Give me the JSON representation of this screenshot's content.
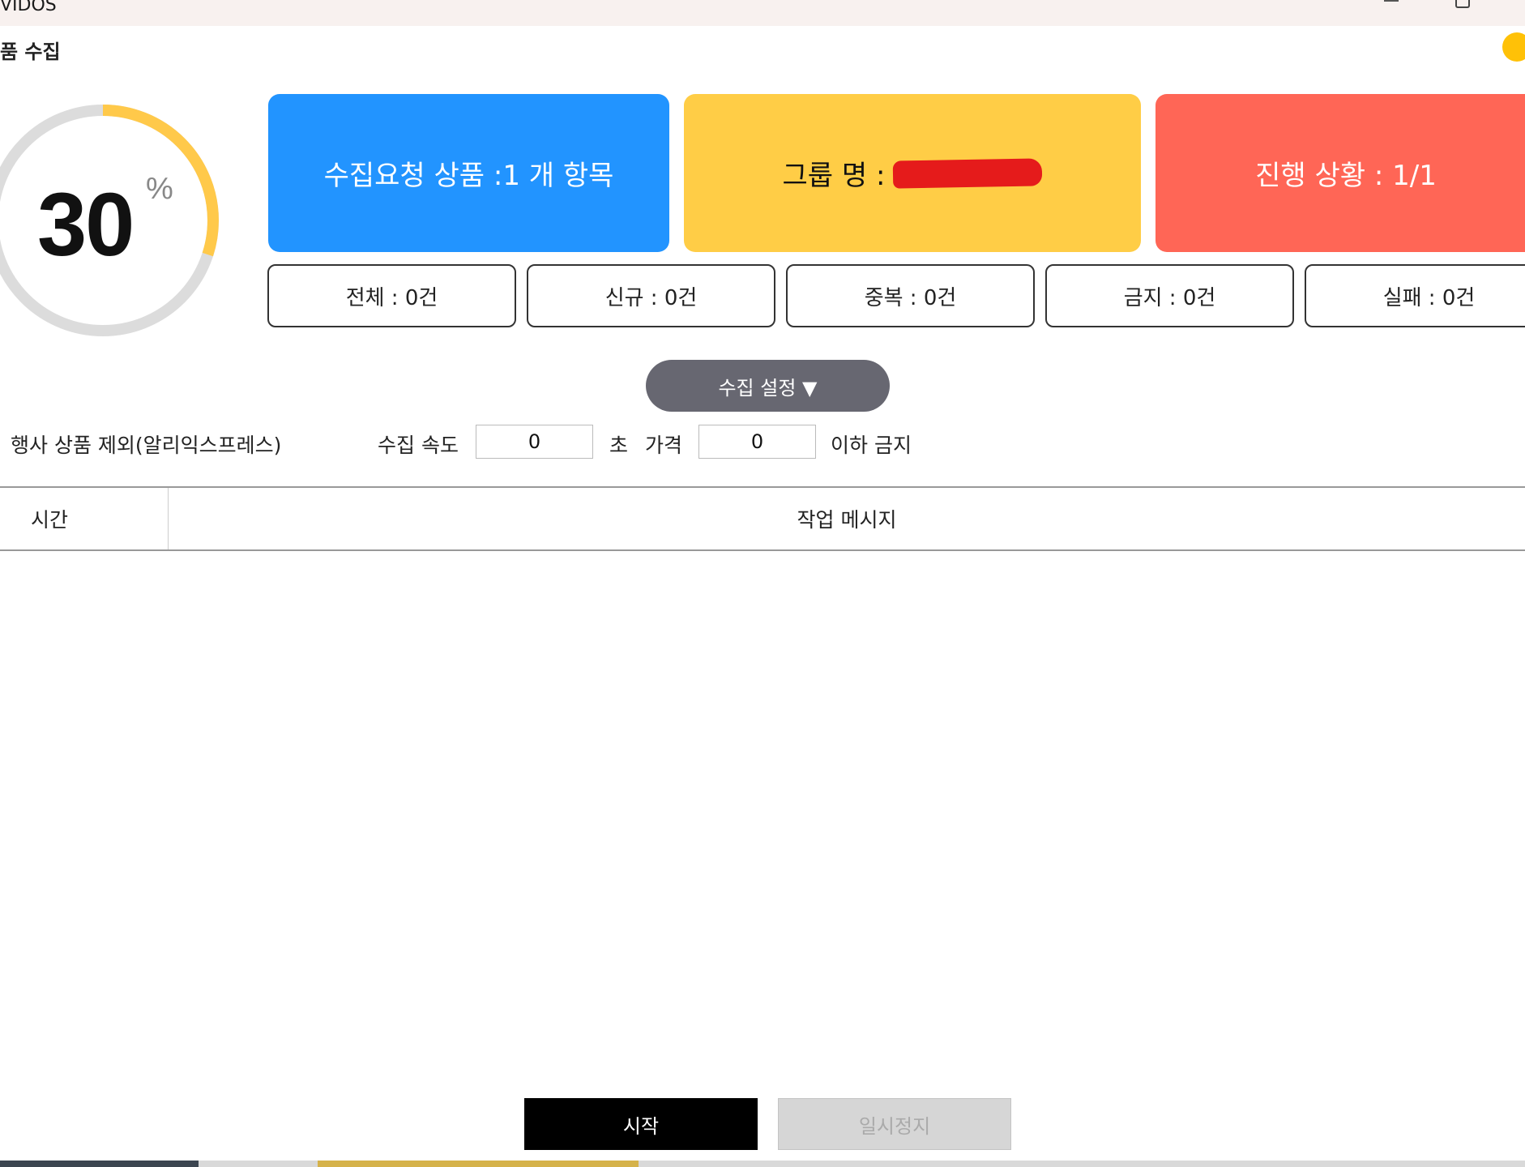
{
  "window": {
    "title": "VIDOS"
  },
  "page": {
    "heading": "품 수집"
  },
  "progress": {
    "value": "30",
    "unit": "%",
    "percent": 30,
    "track_color": "#dcdcdc",
    "fill_color": "#ffc94a"
  },
  "cards": {
    "request": "수집요청 상품 :1 개 항목",
    "group": "그룹 명 :",
    "status": "진행 상황 : 1/1"
  },
  "counts": [
    {
      "label": "전체 : 0건"
    },
    {
      "label": "신규 : 0건"
    },
    {
      "label": "중복 : 0건"
    },
    {
      "label": "금지 : 0건"
    },
    {
      "label": "실패 : 0건"
    }
  ],
  "settings": {
    "toggle_label": "수집 설정 ▼",
    "exclude_event_label": "행사 상품 제외(알리익스프레스)",
    "speed_label": "수집 속도",
    "speed_value": "0",
    "seconds_label": "초",
    "price_label": "가격",
    "price_value": "0",
    "below_ban_label": "이하 금지"
  },
  "log_table": {
    "columns": [
      "시간",
      "작업 메시지"
    ],
    "rows": []
  },
  "actions": {
    "start": "시작",
    "pause": "일시정지"
  },
  "colors": {
    "blue": "#2294ff",
    "yellow": "#ffcd46",
    "red": "#ff6656",
    "pill": "#676771"
  }
}
